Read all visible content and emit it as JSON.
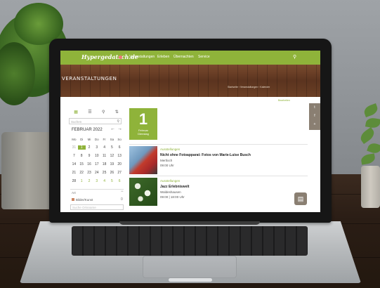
{
  "site": {
    "logo": "Hypergedatsch.de",
    "nav": [
      "Veranstaltungen",
      "Erleben",
      "Übernachten",
      "Service"
    ],
    "search_icon": "search-icon"
  },
  "banner": {
    "title": "VERANSTALTUNGEN",
    "breadcrumb": "Startseite › Veranstaltungen › Kalender"
  },
  "sidebar": {
    "view_icons": [
      "grid-icon",
      "list-icon",
      "location-icon",
      "filter-icon"
    ],
    "search_placeholder": "Suchen",
    "month": "FEBRUAR 2022",
    "weekdays": [
      "Mo",
      "Di",
      "Mi",
      "Do",
      "Fr",
      "Sa",
      "So"
    ],
    "weeks": [
      [
        "31",
        "1",
        "2",
        "3",
        "4",
        "5",
        "6"
      ],
      [
        "7",
        "8",
        "9",
        "10",
        "11",
        "12",
        "13"
      ],
      [
        "14",
        "15",
        "16",
        "17",
        "18",
        "19",
        "20"
      ],
      [
        "21",
        "22",
        "23",
        "24",
        "25",
        "26",
        "27"
      ],
      [
        "28",
        "1",
        "2",
        "3",
        "4",
        "5",
        "6"
      ]
    ],
    "selected_day": "1",
    "footer_label": "Art",
    "filter_label": "Bilder/Kunst",
    "filter_count": "0",
    "second_placeholder": "Suche Ortsname"
  },
  "content": {
    "link": "Bearbeiten",
    "day": {
      "number": "1",
      "line1": "Februar",
      "line2": "Dienstag"
    },
    "events": [
      {
        "category": "Ausstellungen",
        "title": "Nicht ohne Fotoapparat: Fotos von Marie-Luise Busch",
        "place": "Mertloch",
        "time": "09:00 Uhr"
      },
      {
        "category": "Ausstellungen",
        "title": "Jazz Erlebniswelt",
        "place": "Waldeshausen",
        "time": "09:00 | 18:00 Uhr"
      }
    ]
  },
  "social": [
    "twitter-icon",
    "facebook-icon",
    "share-icon"
  ],
  "colors": {
    "brand_green": "#8fb33a",
    "wood": "#6b3f25",
    "social_bg": "#8a7f72"
  }
}
